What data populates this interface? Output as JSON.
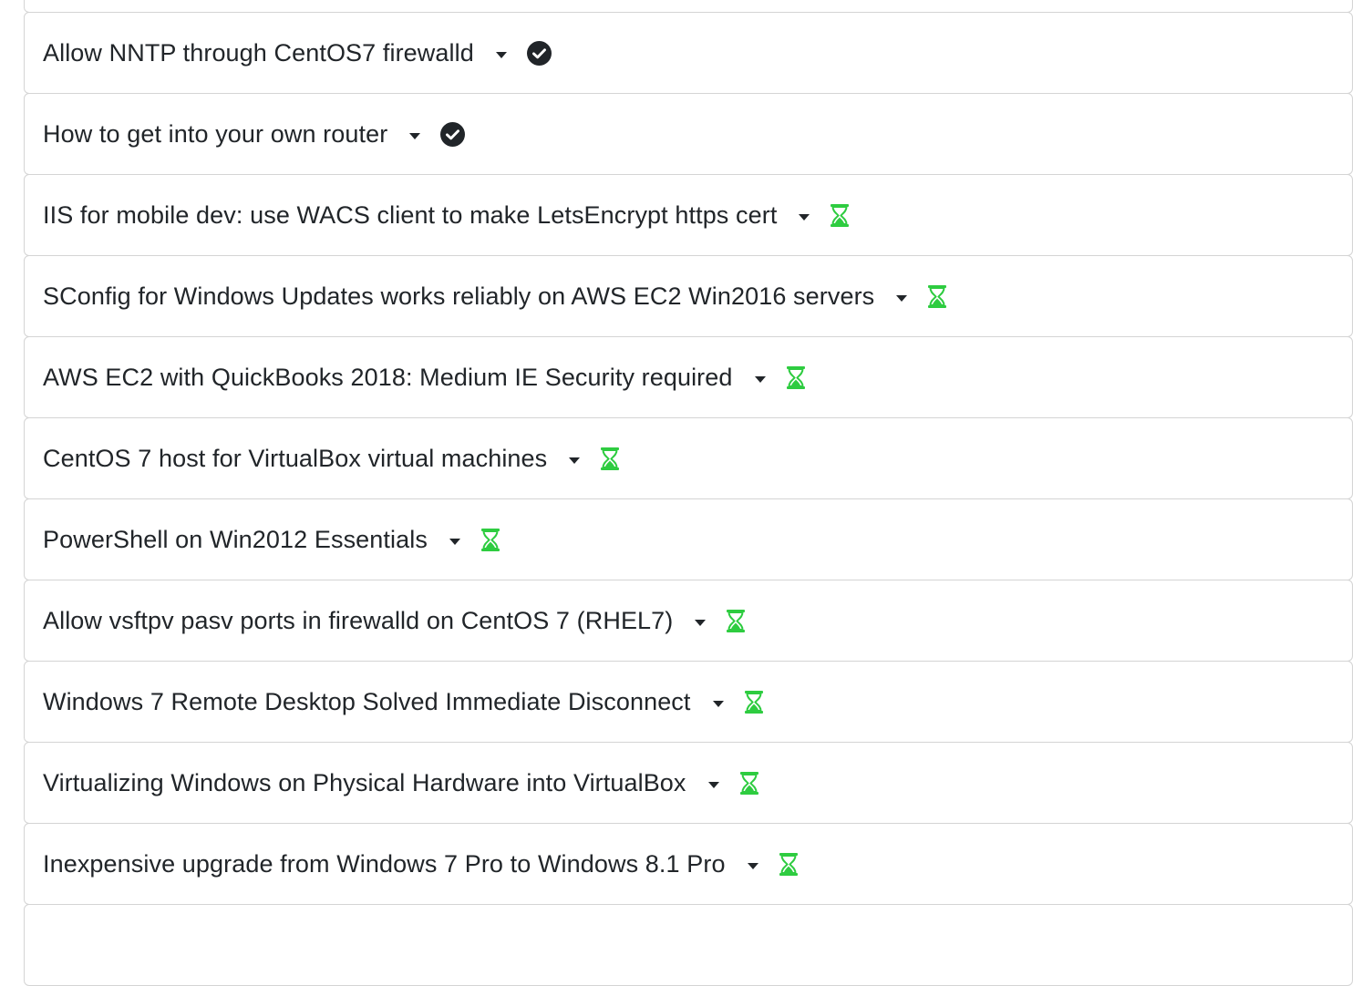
{
  "items": [
    {
      "title": "",
      "status": "none"
    },
    {
      "title": "Allow NNTP through CentOS7 firewalld",
      "status": "check-circle-icon"
    },
    {
      "title": "How to get into your own router",
      "status": "check-circle-icon"
    },
    {
      "title": "IIS for mobile dev: use WACS client to make LetsEncrypt https cert",
      "status": "hourglass-icon"
    },
    {
      "title": "SConfig for Windows Updates works reliably on AWS EC2 Win2016 servers",
      "status": "hourglass-icon"
    },
    {
      "title": "AWS EC2 with QuickBooks 2018: Medium IE Security required",
      "status": "hourglass-icon"
    },
    {
      "title": "CentOS 7 host for VirtualBox virtual machines",
      "status": "hourglass-icon"
    },
    {
      "title": "PowerShell on Win2012 Essentials",
      "status": "hourglass-icon"
    },
    {
      "title": "Allow vsftpv pasv ports in firewalld on CentOS 7 (RHEL7)",
      "status": "hourglass-icon"
    },
    {
      "title": "Windows 7 Remote Desktop Solved Immediate Disconnect",
      "status": "hourglass-icon"
    },
    {
      "title": "Virtualizing Windows on Physical Hardware into VirtualBox",
      "status": "hourglass-icon"
    },
    {
      "title": "Inexpensive upgrade from Windows 7 Pro to Windows 8.1 Pro",
      "status": "hourglass-icon"
    },
    {
      "title": "",
      "status": "none"
    }
  ],
  "colors": {
    "check": "#212529",
    "hourglass": "#2ecc40",
    "border": "#d4d4d4"
  }
}
